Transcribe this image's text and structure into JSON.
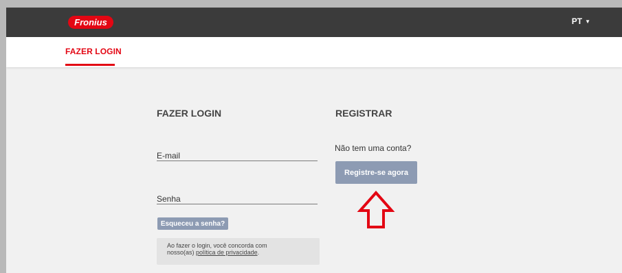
{
  "header": {
    "logo_text": "Fronius",
    "language": "PT",
    "brand_color": "#e30613",
    "bar_color": "#3b3b3b"
  },
  "tabs": [
    {
      "label": "FAZER LOGIN",
      "active": true
    }
  ],
  "login": {
    "title": "FAZER LOGIN",
    "email_label": "E-mail",
    "password_label": "Senha",
    "forgot_label": "Esqueceu a senha?",
    "notice_text_1": "Ao fazer o login, você concorda com",
    "notice_text_2": "nosso(as) ",
    "privacy_link": "política de privacidade",
    "notice_end": "."
  },
  "register": {
    "title": "REGISTRAR",
    "prompt": "Não tem uma conta?",
    "button_label": "Registre-se agora",
    "button_color": "#8d9bb3"
  },
  "annotation": {
    "arrow_color": "#e30613",
    "arrow_icon": "up-arrow-outline"
  }
}
